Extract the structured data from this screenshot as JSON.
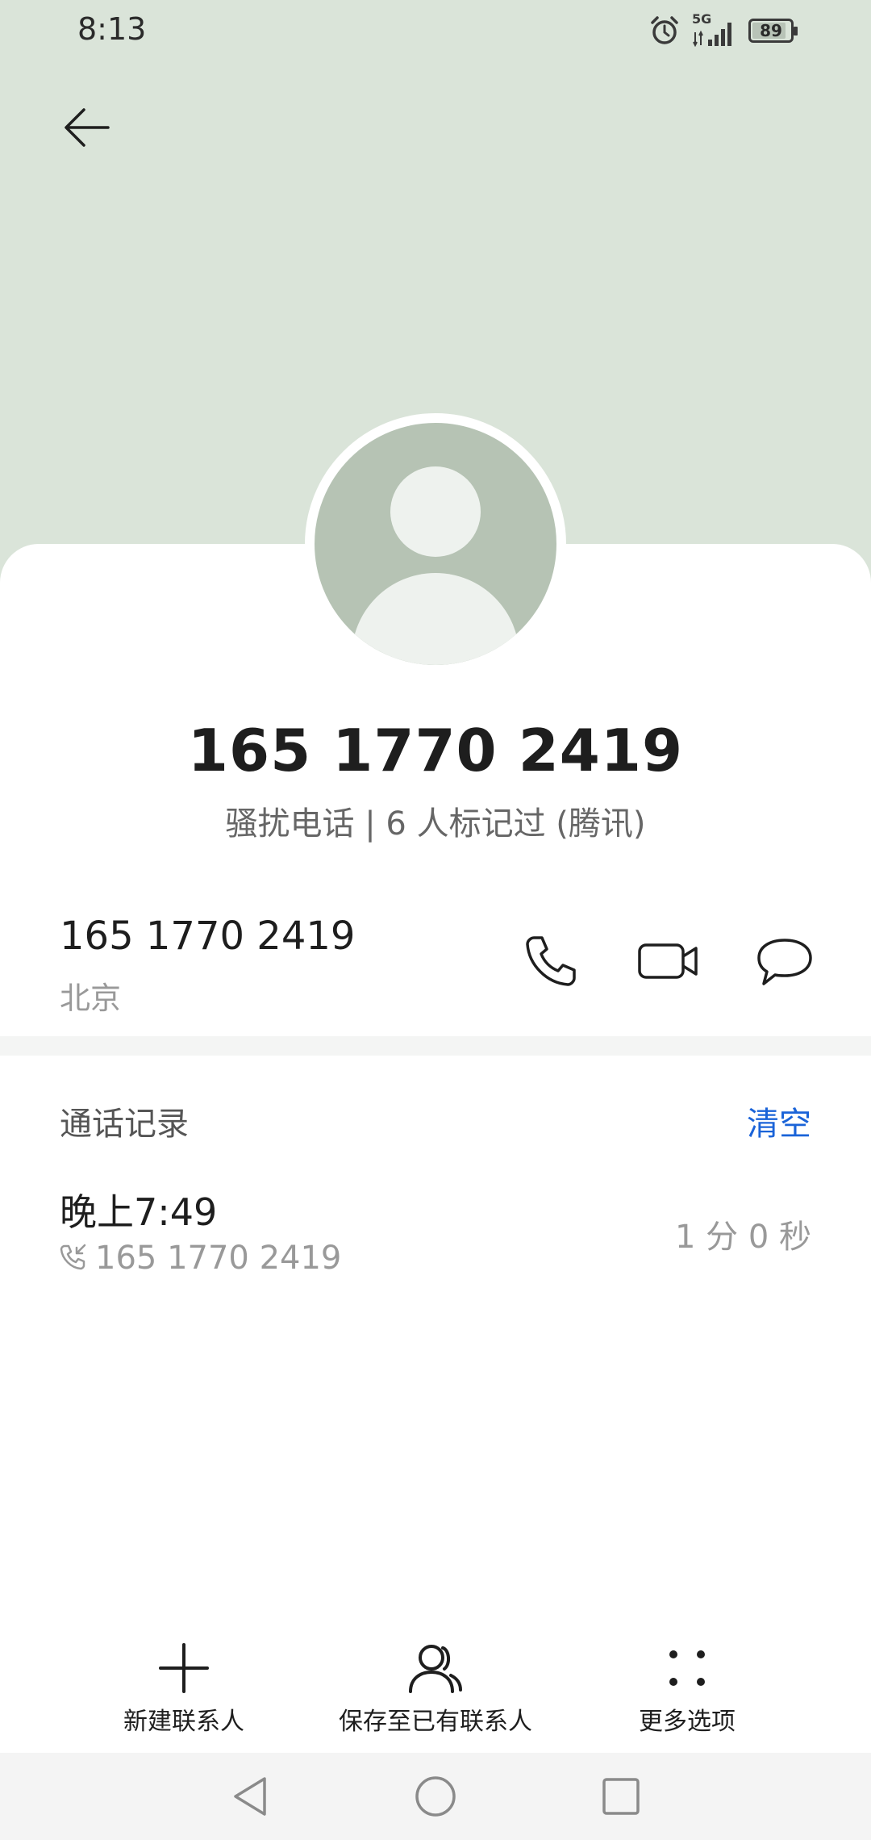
{
  "status_bar": {
    "time": "8:13",
    "network": "5G",
    "battery_percent": "89",
    "battery_level": 0.89,
    "icons": [
      "alarm-icon",
      "signal-icon",
      "battery-icon"
    ]
  },
  "header": {
    "back_icon": "back-arrow-icon",
    "background_color": "#dae4d9"
  },
  "contact": {
    "display_number": "165 1770 2419",
    "tag": "骚扰电话 | 6 人标记过 (腾讯)",
    "avatar_icon": "person-placeholder-icon"
  },
  "number_row": {
    "number": "165 1770 2419",
    "location": "北京",
    "actions": [
      {
        "name": "call",
        "icon": "phone-icon"
      },
      {
        "name": "video-call",
        "icon": "video-camera-icon"
      },
      {
        "name": "message",
        "icon": "chat-bubble-icon"
      }
    ]
  },
  "call_log": {
    "title": "通话记录",
    "clear_label": "清空",
    "entries": [
      {
        "time": "晚上7:49",
        "number": "165 1770 2419",
        "duration": "1 分 0 秒",
        "type_icon": "incoming-call-icon"
      }
    ]
  },
  "bottom_bar": {
    "items": [
      {
        "label": "新建联系人",
        "icon": "plus-icon"
      },
      {
        "label": "保存至已有联系人",
        "icon": "contacts-icon"
      },
      {
        "label": "更多选项",
        "icon": "more-dots-icon"
      }
    ]
  },
  "nav_bar": {
    "buttons": [
      "back-triangle-icon",
      "home-circle-icon",
      "recents-square-icon"
    ]
  },
  "colors": {
    "accent": "#1a63d8",
    "header_bg": "#dae4d9",
    "avatar_bg": "#b6c3b4",
    "secondary_text": "#999999"
  }
}
